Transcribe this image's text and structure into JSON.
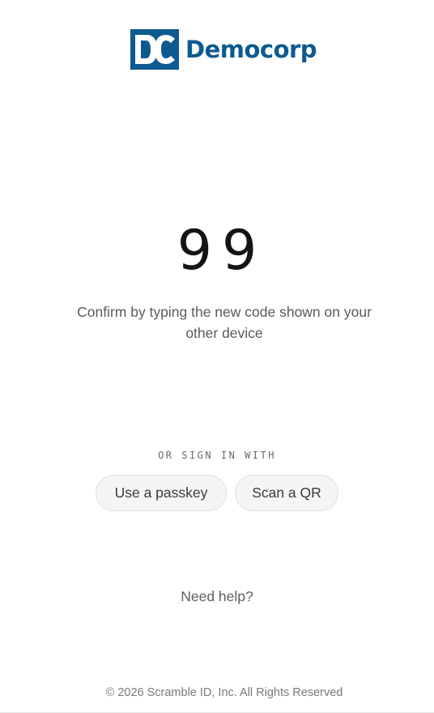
{
  "brand": {
    "name": "Democorp",
    "mark_text": "DC",
    "color": "#0d5a91"
  },
  "verification": {
    "code": "99",
    "instruction": "Confirm by typing the new code shown on your other device"
  },
  "alternatives": {
    "label": "OR SIGN IN WITH",
    "passkey_label": "Use a passkey",
    "qr_label": "Scan a QR"
  },
  "help": {
    "label": "Need help?"
  },
  "footer": {
    "copyright": "© 2026 Scramble ID, Inc. All Rights Reserved"
  }
}
